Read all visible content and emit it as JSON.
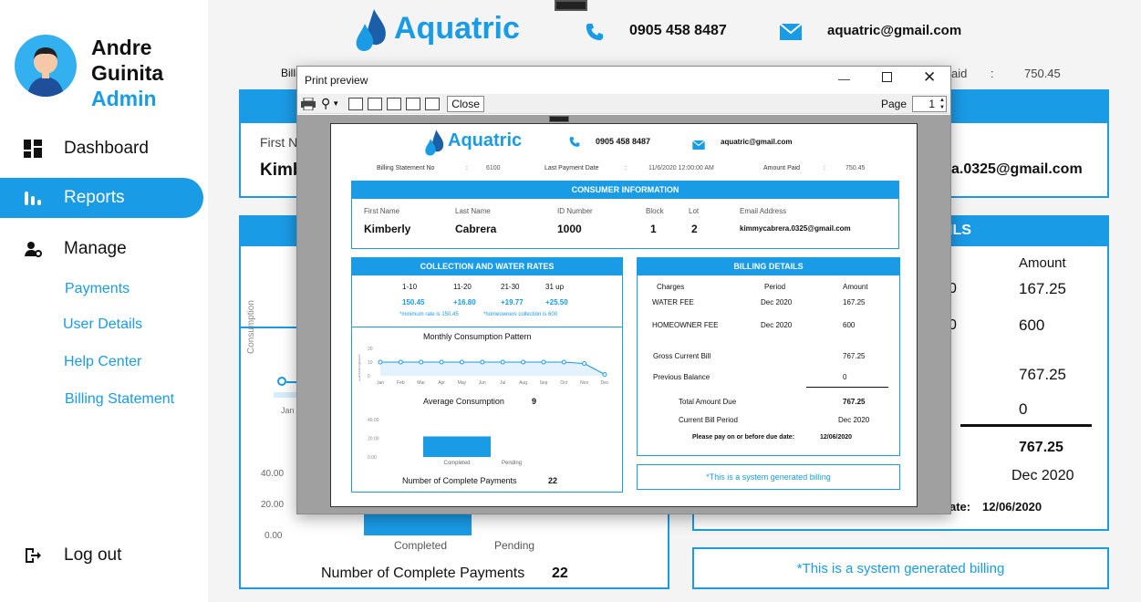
{
  "sidebar": {
    "user_first": "Andre",
    "user_last": "Guinita",
    "role": "Admin",
    "nav": [
      "Dashboard",
      "Reports",
      "Manage"
    ],
    "sub": [
      "Payments",
      "User Details",
      "Help Center",
      "Billing Statement"
    ],
    "logout": "Log out"
  },
  "header": {
    "brand": "Aquatric",
    "phone": "0905 458 8487",
    "email": "aquatric@gmail.com"
  },
  "bg": {
    "billing_label": "Billi",
    "amount_paid_label": "aid",
    "amount_paid_sep": ":",
    "amount_paid": "750.45",
    "first_name_label": "First N",
    "first_name_value": "Kimb",
    "email_value": "a.0325@gmail.com",
    "details_head_fragment": "ILS",
    "amount_head": "Amount",
    "amounts": [
      "167.25",
      "600",
      "767.25",
      "0"
    ],
    "zero_frag1": "0",
    "zero_frag2": "0",
    "total": "767.25",
    "period": "Dec 2020",
    "due_label": "ate:",
    "due_date": "12/06/2020",
    "system_note": "*This is a system generated billing",
    "consumption_label": "Consumption",
    "jan": "Jan",
    "y_ticks": [
      "40.00",
      "20.00",
      "0.00"
    ],
    "bar_labels": [
      "Completed",
      "Pending"
    ],
    "complete_payments_label": "Number of Complete Payments",
    "complete_payments_value": "22"
  },
  "preview": {
    "title": "Print preview",
    "close_btn": "Close",
    "page_label": "Page",
    "page_value": "1",
    "brand": "Aquatric",
    "phone": "0905 458 8487",
    "email": "aquatric@gmail.com",
    "billing_no_label": "Billing Statement No",
    "sep": ":",
    "billing_no": "6100",
    "last_payment_label": "Last Payment Date",
    "last_payment": "11/6/2020 12:00:00 AM",
    "amount_paid_label": "Amount Paid",
    "amount_paid": "750.45",
    "consumer_head": "CONSUMER INFORMATION",
    "consumer_labels": [
      "First Name",
      "Last Name",
      "ID Number",
      "Block",
      "Lot",
      "Email Address"
    ],
    "consumer_values": [
      "Kimberly",
      "Cabrera",
      "1000",
      "1",
      "2",
      "kimmycabrera.0325@gmail.com"
    ],
    "rates_head": "COLLECTION AND WATER RATES",
    "rate_ranges": [
      "1-10",
      "11-20",
      "21-30",
      "31 up"
    ],
    "rate_values": [
      "150.45",
      "+16.80",
      "+19.77",
      "+25.50"
    ],
    "rate_note1": "*minimum rate is 150.45",
    "rate_note2": "*homeowners collection is 600",
    "chart_title": "Monthly Consumption Pattern",
    "avg_label": "Average Consumption",
    "avg_value": "9",
    "complete_label": "Number of Complete Payments",
    "complete_value": "22",
    "billing_head": "BILLING DETAILS",
    "billing_cols": [
      "Charges",
      "Period",
      "Amount"
    ],
    "water_fee": [
      "WATER FEE",
      "Dec 2020",
      "167.25"
    ],
    "homeowner_fee": [
      "HOMEOWNER FEE",
      "Dec 2020",
      "600"
    ],
    "gross_label": "Gross Current Bill",
    "gross_value": "767.25",
    "prev_label": "Previous Balance",
    "prev_value": "0",
    "total_label": "Total Amount Due",
    "total_value": "767.25",
    "period_label": "Current Bill Period",
    "period_value": "Dec 2020",
    "due_text": "Please pay on or before due date:",
    "due_date": "12/06/2020",
    "system_note": "*This is a system generated billing"
  },
  "chart_data": [
    {
      "type": "line",
      "title": "Monthly Consumption Pattern",
      "ylabel": "Consumption",
      "categories": [
        "Jan",
        "Feb",
        "Mar",
        "Apr",
        "May",
        "Jun",
        "Jul",
        "Aug",
        "Sep",
        "Oct",
        "Nov",
        "Dec"
      ],
      "series": [
        {
          "values": [
            10,
            10,
            10,
            10,
            10,
            10,
            10,
            10,
            10,
            10,
            9,
            1
          ]
        }
      ],
      "ylim": [
        0,
        20
      ],
      "y_ticks": [
        "20",
        "10",
        "0"
      ]
    },
    {
      "type": "bar",
      "categories": [
        "Completed",
        "Pending"
      ],
      "values": [
        22,
        0
      ],
      "ylim": [
        0,
        40
      ],
      "y_ticks": [
        "40.00",
        "20.00",
        "0.00"
      ]
    }
  ],
  "colors": {
    "accent": "#1a9be6",
    "dark": "#111111"
  }
}
